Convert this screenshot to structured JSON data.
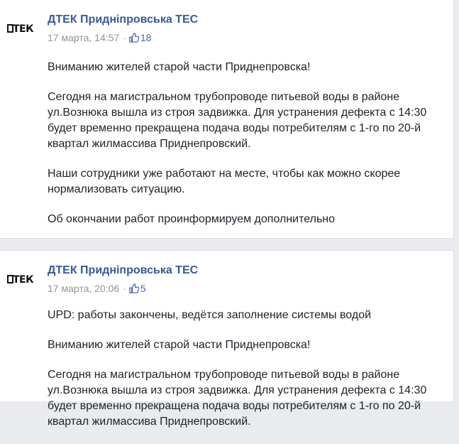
{
  "posts": [
    {
      "logo": "DTEK",
      "author": "ДТЕК Придніпровська ТЕС",
      "date": "17 марта, 14:57",
      "separator": "·",
      "likes": "18",
      "icons": {
        "like": "thumbs-up-icon"
      },
      "paragraphs": [
        "Вниманию жителей старой части Приднепровска!",
        "Сегодня на магистральном трубопроводе питьевой воды в районе ул.Вознюка вышла из строя задвижка. Для устранения дефекта с 14:30 будет временно прекращена подача воды потребителям с 1-го по 20-й квартал жилмассива Приднепровский.",
        "Наши сотрудники уже работают на месте, чтобы как можно скорее нормализовать ситуацию.",
        "Об окончании работ проинформируем дополнительно"
      ]
    },
    {
      "logo": "DTEK",
      "author": "ДТЕК Придніпровська ТЕС",
      "date": "17 марта, 20:06",
      "separator": "·",
      "likes": "5",
      "icons": {
        "like": "thumbs-up-icon"
      },
      "paragraphs": [
        "UPD: работы закончены, ведётся заполнение системы водой",
        "Вниманию жителей старой части Приднепровска!",
        "Сегодня на магистральном трубопроводе питьевой воды в районе ул.Вознюка вышла из строя задвижка. Для устранения дефекта с 14:30 будет временно прекращена подача воды потребителям с 1-го по 20-й квартал жилмассива Приднепровский."
      ]
    }
  ],
  "colors": {
    "author": "#385898",
    "meta": "#90949c",
    "like": "#4267b2",
    "text": "#1d2129",
    "background": "#e9ebee"
  }
}
